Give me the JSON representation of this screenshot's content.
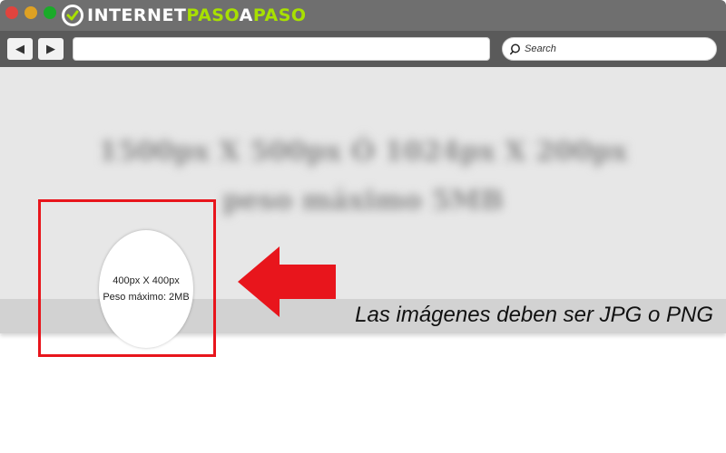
{
  "window": {
    "logo_part1": "INTERNET",
    "logo_part2": "PASO",
    "logo_part3": "A",
    "logo_part4": "PASO",
    "colors": {
      "logo_accent": "#a8e000",
      "titlebar": "#6f6f6f",
      "toolbar": "#5a5a5a"
    }
  },
  "toolbar": {
    "back_icon": "◀",
    "forward_icon": "▶",
    "url_value": "",
    "search_placeholder": "Search"
  },
  "page": {
    "blurred_line1": "1500px X 500px Ó 1024px X 200px",
    "blurred_line2": "peso máximo 5MB",
    "avatar_size": "400px X 400px",
    "avatar_weight": "Peso máximo: 2MB",
    "strip_text": "Las imágenes deben ser JPG o PNG",
    "colors": {
      "highlight": "#e8151c",
      "banner": "#e7e7e7",
      "strip": "#d2d2d2"
    }
  }
}
